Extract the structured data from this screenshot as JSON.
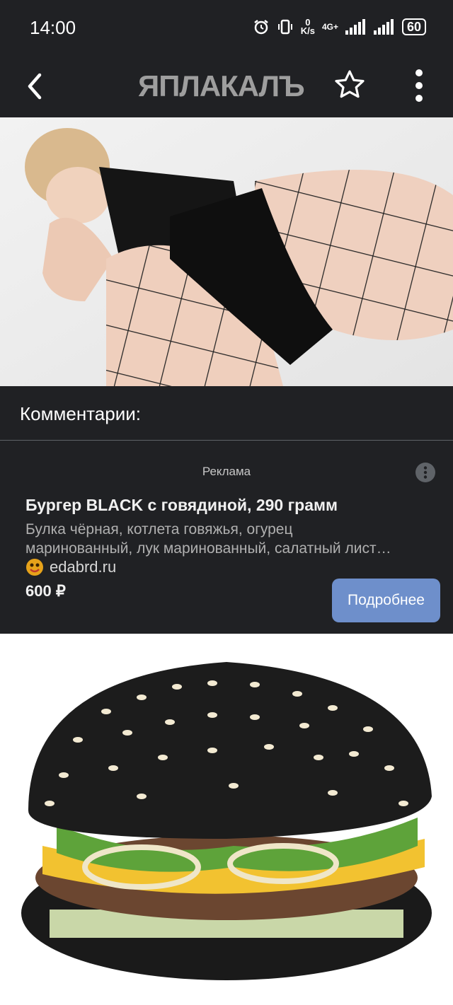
{
  "status": {
    "time": "14:00",
    "data_rate": "0",
    "data_unit": "K/s",
    "network": "4G+",
    "battery": "60"
  },
  "appbar": {
    "logo_text": "ЯПЛАКАЛЪ",
    "back_icon": "chevron-left-icon",
    "star_icon": "star-outline-icon",
    "menu_icon": "kebab-menu-icon"
  },
  "comments": {
    "title": "Комментарии:"
  },
  "ad": {
    "label": "Реклама",
    "title": "Бургер BLACK с говядиной, 290 грамм",
    "description_line1": "Булка чёрная, котлета говяжья, огурец",
    "description_line2": "маринованный, лук маринованный, салатный лист…",
    "source": "edabrd.ru",
    "price": "600 ₽",
    "cta_label": "Подробнее"
  },
  "colors": {
    "background": "#202124",
    "cta": "#6e8fcb",
    "logo": "#9e9e9e"
  }
}
